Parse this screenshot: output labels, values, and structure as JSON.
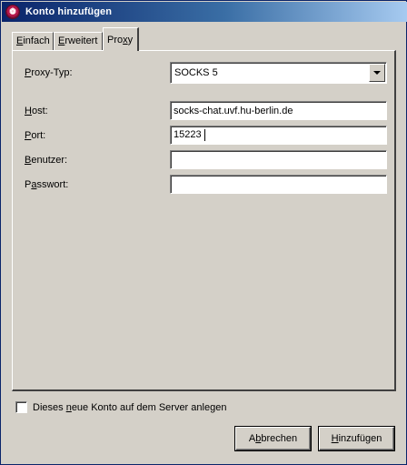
{
  "window": {
    "title": "Konto hinzufügen",
    "icon": "pidgin-app-icon"
  },
  "tabs": [
    {
      "label_pre": "",
      "label_ul": "E",
      "label_post": "infach",
      "active": false
    },
    {
      "label_pre": "",
      "label_ul": "E",
      "label_post": "rweitert",
      "active": false
    },
    {
      "label_pre": "Pro",
      "label_ul": "x",
      "label_post": "y",
      "active": true
    }
  ],
  "proxy": {
    "type_label": {
      "pre": "",
      "ul": "P",
      "post": "roxy-Typ:"
    },
    "type_value": "SOCKS 5",
    "host_label": {
      "pre": "",
      "ul": "H",
      "post": "ost:"
    },
    "host_value": "socks-chat.uvf.hu-berlin.de",
    "port_label": {
      "pre": "",
      "ul": "P",
      "post": "ort:"
    },
    "port_value": "15223",
    "user_label": {
      "pre": "",
      "ul": "B",
      "post": "enutzer:"
    },
    "user_value": "",
    "password_label": {
      "pre": "P",
      "ul": "a",
      "post": "sswort:"
    },
    "password_value": ""
  },
  "options": {
    "create_on_server": {
      "pre": "Dieses ",
      "ul": "n",
      "post": "eue Konto auf dem Server anlegen",
      "checked": false
    }
  },
  "buttons": {
    "cancel": {
      "pre": "A",
      "ul": "b",
      "post": "brechen"
    },
    "add": {
      "pre": "",
      "ul": "H",
      "post": "inzufügen"
    }
  }
}
